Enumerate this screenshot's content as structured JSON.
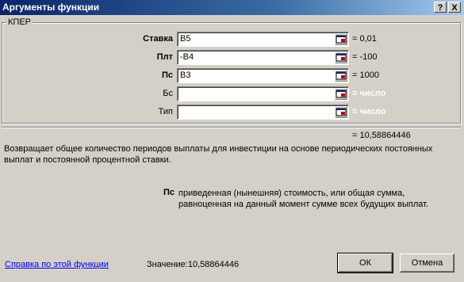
{
  "window": {
    "title": "Аргументы функции",
    "help_label": "?",
    "close_label": "X"
  },
  "function": {
    "name": "КПЕР",
    "args": [
      {
        "label": "Ставка",
        "value": "B5",
        "result": "= 0,01",
        "required": true
      },
      {
        "label": "Плт",
        "value": "-B4",
        "result": "= -100",
        "required": true
      },
      {
        "label": "Пс",
        "value": "B3",
        "result": "= 1000",
        "required": true
      },
      {
        "label": "Бс",
        "value": "",
        "result": "= число",
        "required": false
      },
      {
        "label": "Тип",
        "value": "",
        "result": "= число",
        "required": false
      }
    ],
    "result": "= 10,58864446",
    "description": "Возвращает общее количество периодов выплаты для инвестиции на основе периодических постоянных выплат и постоянной процентной ставки.",
    "current_arg": {
      "name": "Пс",
      "description": "приведенная (нынешняя) стоимость, или общая сумма, равноценная на данный момент сумме всех будущих выплат."
    }
  },
  "footer": {
    "help_link": "Справка по этой функции",
    "value_label": "Значение:",
    "value": "10,58864446",
    "ok_label": "ОК",
    "cancel_label": "Отмена"
  },
  "colors": {
    "titlebar_start": "#0a246a",
    "titlebar_end": "#a6caf0",
    "dialog_bg": "#d4d0c8",
    "link": "#0000ff"
  }
}
